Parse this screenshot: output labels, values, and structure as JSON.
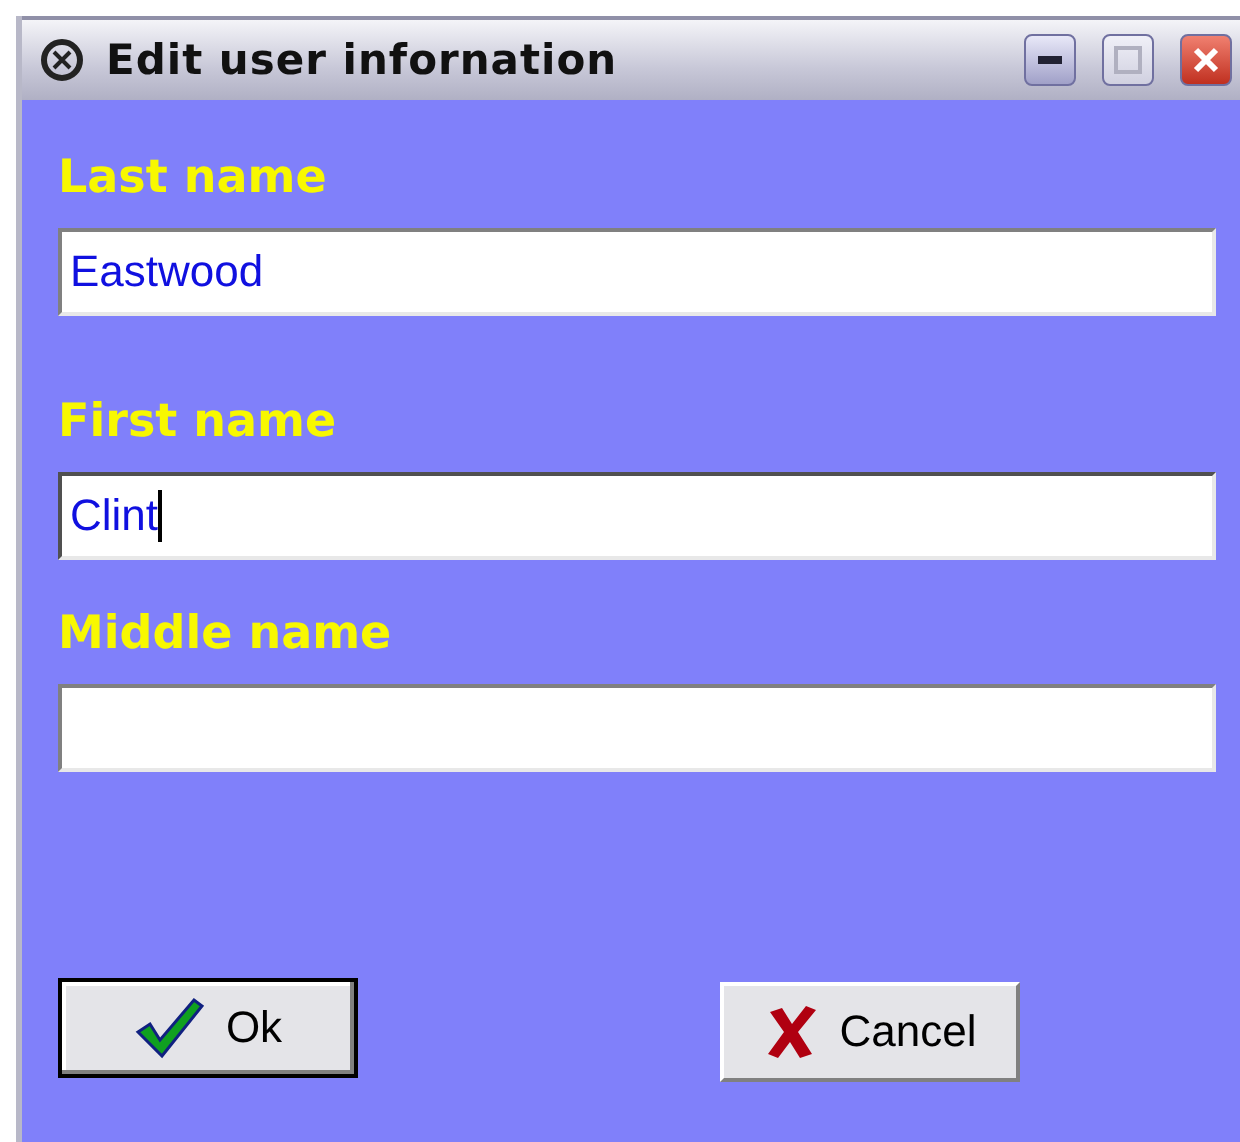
{
  "window": {
    "title": "Edit user infornation"
  },
  "fields": [
    {
      "label": "Last name",
      "value": "Eastwood",
      "focused": false
    },
    {
      "label": "First name",
      "value": "Clint",
      "focused": true
    },
    {
      "label": "Middle name",
      "focused": false
    }
  ],
  "buttons": [
    {
      "kind": "ok",
      "label": "Ok",
      "default": true
    },
    {
      "kind": "cancel",
      "label": "Cancel",
      "default": false
    }
  ]
}
